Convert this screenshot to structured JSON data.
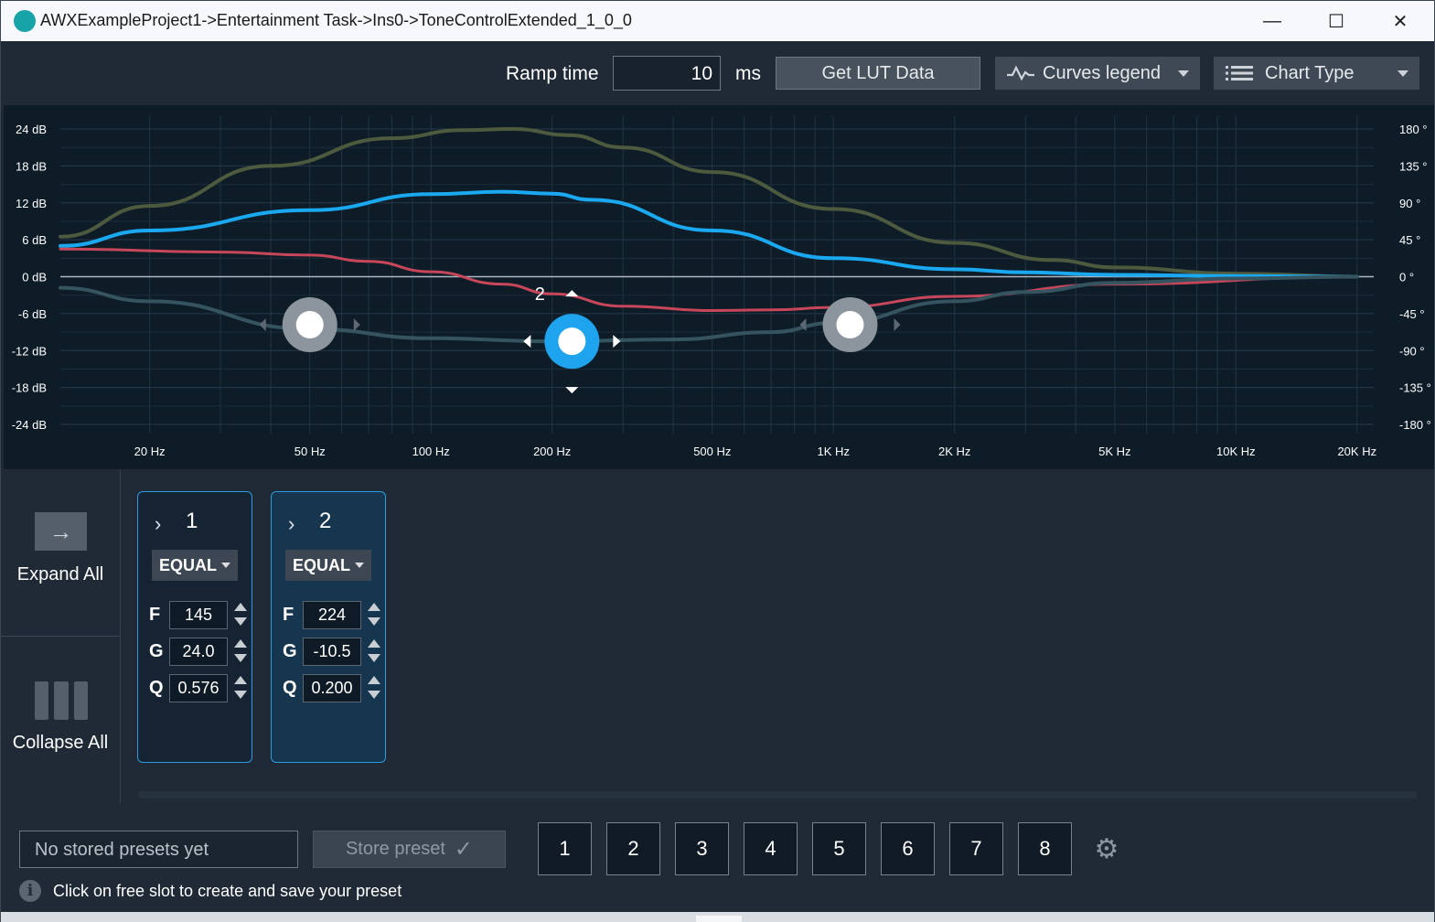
{
  "window": {
    "title": "AWXExampleProject1->Entertainment Task->Ins0->ToneControlExtended_1_0_0",
    "minimize_glyph": "—",
    "maximize_glyph": "☐",
    "close_glyph": "✕"
  },
  "toolbar": {
    "ramp_label": "Ramp time",
    "ramp_value": "10",
    "ramp_unit": "ms",
    "lut_button": "Get LUT Data",
    "curves_legend": "Curves legend",
    "chart_type": "Chart Type"
  },
  "chart_data": {
    "type": "line",
    "x_scale": "log",
    "xlim": [
      12,
      22000
    ],
    "ylim": [
      -24,
      24
    ],
    "y2lim": [
      -180,
      180
    ],
    "x_ticks": [
      20,
      50,
      100,
      200,
      500,
      1000,
      2000,
      5000,
      10000,
      20000
    ],
    "x_tick_labels": [
      "20 Hz",
      "50 Hz",
      "100 Hz",
      "200 Hz",
      "500 Hz",
      "1K Hz",
      "2K Hz",
      "5K Hz",
      "10K Hz",
      "20K Hz"
    ],
    "y_ticks": [
      24,
      18,
      12,
      6,
      0,
      -6,
      -12,
      -18,
      -24
    ],
    "y_tick_labels": [
      "24 dB",
      "18 dB",
      "12 dB",
      "6 dB",
      "0 dB",
      "-6 dB",
      "-12 dB",
      "-18 dB",
      "-24 dB"
    ],
    "y2_ticks": [
      180,
      135,
      90,
      45,
      0,
      -45,
      -90,
      -135,
      -180
    ],
    "y2_tick_labels": [
      "180 °",
      "135 °",
      "90 °",
      "45 °",
      "0 °",
      "-45 °",
      "-90 °",
      "-135 °",
      "-180 °"
    ],
    "grid": true,
    "series": [
      {
        "color": "#4e5a3e",
        "width": 4,
        "axis": "left",
        "x": [
          12,
          20,
          40,
          80,
          120,
          160,
          220,
          300,
          500,
          1000,
          2000,
          3500,
          5000,
          10000,
          20000
        ],
        "y": [
          6.5,
          11.5,
          18,
          22.5,
          23.8,
          24,
          23,
          21,
          17,
          11,
          5.5,
          2.7,
          1.5,
          0.5,
          0
        ]
      },
      {
        "color": "#1aa8f0",
        "width": 4,
        "axis": "left",
        "x": [
          12,
          20,
          50,
          100,
          150,
          200,
          250,
          500,
          1000,
          2000,
          3000,
          5000,
          10000,
          20000
        ],
        "y": [
          5,
          7.5,
          10.8,
          13.4,
          13.8,
          13.5,
          12.5,
          7.5,
          3,
          1.2,
          0.7,
          0.3,
          0.1,
          0
        ]
      },
      {
        "color": "#c8465a",
        "width": 3,
        "axis": "left",
        "x": [
          12,
          30,
          50,
          70,
          100,
          150,
          200,
          300,
          500,
          700,
          1000,
          2000,
          5000,
          20000
        ],
        "y": [
          4.5,
          4,
          3.5,
          2.5,
          0.8,
          -1.2,
          -2.8,
          -4.8,
          -5.5,
          -5.4,
          -5,
          -3.2,
          -1.2,
          0
        ]
      },
      {
        "color": "#35545f",
        "width": 4,
        "axis": "left",
        "x": [
          12,
          20,
          50,
          100,
          200,
          400,
          700,
          1000,
          2000,
          3000,
          5000,
          10000,
          20000
        ],
        "y": [
          -1.8,
          -4,
          -8.5,
          -10,
          -10.5,
          -10.2,
          -9,
          -7.5,
          -4,
          -2.5,
          -1,
          -0.3,
          0
        ]
      }
    ],
    "band_handles": [
      {
        "freq": 50,
        "gain_db": -7.8,
        "active": false
      },
      {
        "freq": 224,
        "gain_db": -10.5,
        "active": true,
        "label": "2"
      },
      {
        "freq": 1100,
        "gain_db": -7.8,
        "active": false
      }
    ]
  },
  "side": {
    "expand_label": "Expand All",
    "expand_icon": "→",
    "collapse_label": "Collapse All"
  },
  "bands": [
    {
      "chevron": "›",
      "num": "1",
      "type": "EQUAL",
      "f_label": "F",
      "f": "145",
      "g_label": "G",
      "g": "24.0",
      "q_label": "Q",
      "q": "0.576"
    },
    {
      "chevron": "›",
      "num": "2",
      "type": "EQUAL",
      "f_label": "F",
      "f": "224",
      "g_label": "G",
      "g": "-10.5",
      "q_label": "Q",
      "q": "0.200"
    }
  ],
  "presets": {
    "placeholder": "No stored presets yet",
    "store_label": "Store preset",
    "store_check": "✓",
    "slots": [
      "1",
      "2",
      "3",
      "4",
      "5",
      "6",
      "7",
      "8"
    ],
    "gear_glyph": "⚙",
    "info_glyph": "i",
    "info_text": "Click on free slot to create and save your preset"
  }
}
